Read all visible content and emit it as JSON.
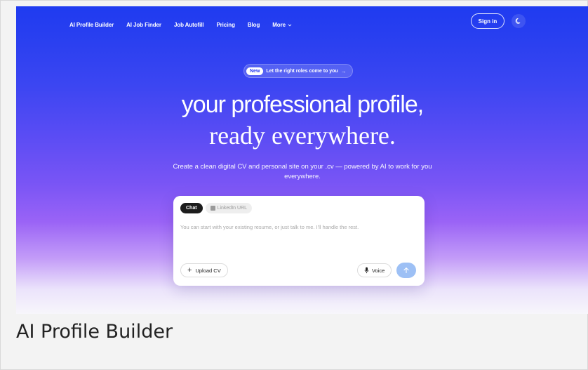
{
  "nav": {
    "items": [
      {
        "label": "AI Profile Builder"
      },
      {
        "label": "AI Job Finder"
      },
      {
        "label": "Job Autofill"
      },
      {
        "label": "Pricing"
      },
      {
        "label": "Blog"
      },
      {
        "label": "More",
        "icon": "chevron-down-icon"
      }
    ],
    "signin_label": "Sign in",
    "theme_icon": "moon-icon"
  },
  "badge": {
    "tag": "New",
    "text": "Let the right roles come to you",
    "icon": "arrow-right-icon"
  },
  "hero": {
    "headline_line1": "your professional profile,",
    "headline_line2": "ready everywhere.",
    "subtitle": "Create a clean digital CV and personal site on your .cv — powered by AI to work for you everywhere."
  },
  "composer": {
    "tabs": [
      {
        "label": "Chat",
        "active": true
      },
      {
        "label": "LinkedIn URL",
        "icon": "linkedin-icon",
        "active": false
      }
    ],
    "placeholder": "You can start with your existing resume, or just talk to me. I'll handle the rest.",
    "upload_label": "Upload CV",
    "voice_label": "Voice",
    "send_icon": "arrow-up-icon"
  },
  "caption": "AI Profile Builder",
  "colors": {
    "gradient_top": "#1f3bf0",
    "gradient_mid": "#7a55f5",
    "gradient_bottom": "#f7f6fb",
    "send_button": "#9dc0f5",
    "chat_tab": "#1c1c1c"
  }
}
